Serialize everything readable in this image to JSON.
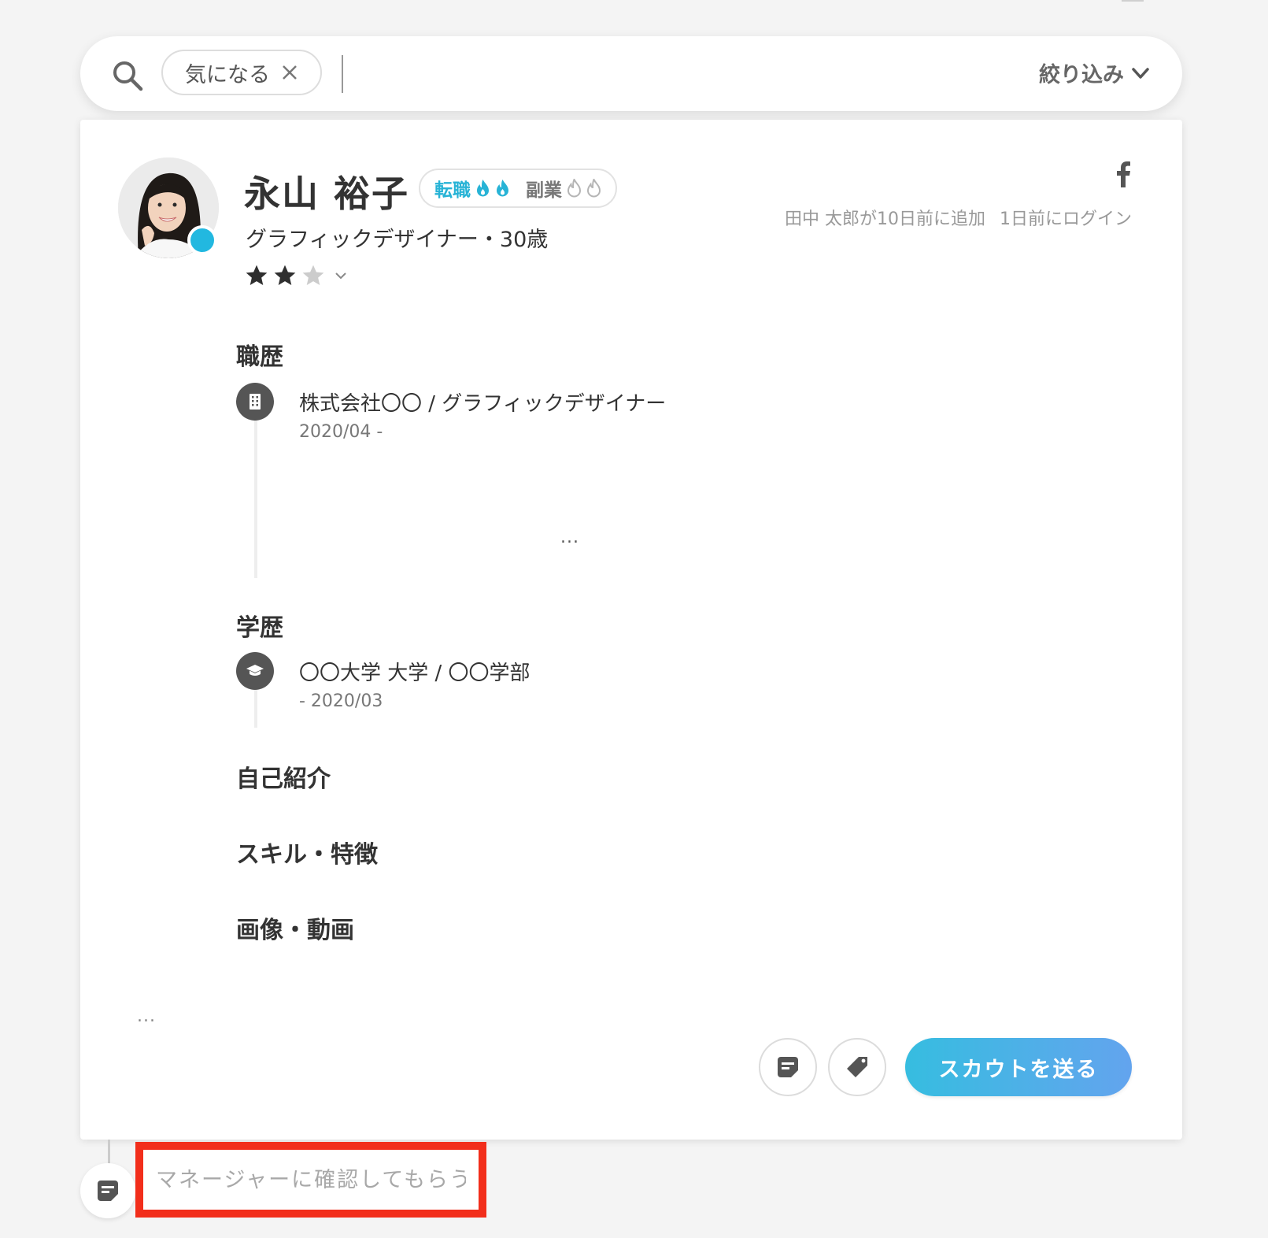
{
  "search": {
    "chip_label": "気になる",
    "filter_label": "絞り込み"
  },
  "candidate": {
    "name": "永山 裕子",
    "intent": {
      "job_change_label": "転職",
      "side_job_label": "副業"
    },
    "subtitle": "グラフィックデザイナー・30歳",
    "rating": 2,
    "rating_max": 3,
    "added_by": "田中 太郎が10日前に追加",
    "last_login": "1日前にログイン"
  },
  "sections": {
    "career_heading": "職歴",
    "career": [
      {
        "title": "株式会社〇〇 / グラフィックデザイナー",
        "period": "2020/04 -"
      }
    ],
    "more_indicator": "...",
    "education_heading": "学歴",
    "education": [
      {
        "title": "〇〇大学 大学 / 〇〇学部",
        "period": "- 2020/03"
      }
    ],
    "self_intro_heading": "自己紹介",
    "skills_heading": "スキル・特徴",
    "media_heading": "画像・動画"
  },
  "actions": {
    "more_label": "...",
    "scout_label": "スカウトを送る"
  },
  "memo": {
    "placeholder": "マネージャーに確認してもらう"
  },
  "colors": {
    "accent": "#27b3d6",
    "scout_gradient_start": "#36bde0",
    "scout_gradient_end": "#63a4ee",
    "highlight_border": "#f22e1b"
  },
  "icons": {
    "search": "search-icon",
    "chip_close": "close-icon",
    "filter": "chevron-down-icon",
    "social": "facebook-icon",
    "career": "building-icon",
    "education": "graduation-cap-icon",
    "memo": "memo-icon",
    "tag": "tag-icon"
  }
}
